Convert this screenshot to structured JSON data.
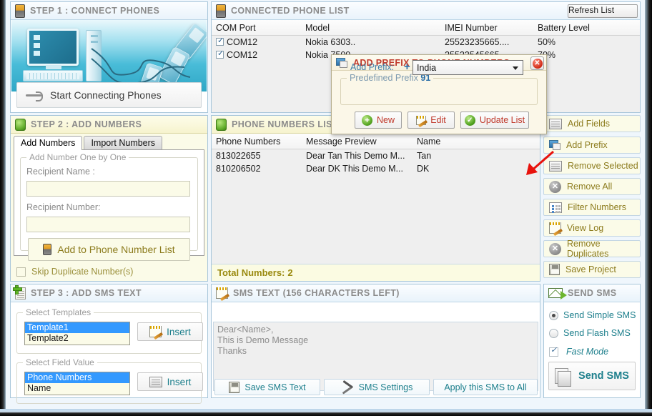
{
  "step1": {
    "title": "STEP 1 : CONNECT PHONES",
    "icon": "mobile-phone-icon",
    "start_button": "Start Connecting Phones",
    "usb_icon": "usb-icon"
  },
  "connected_phone_list": {
    "title": "CONNECTED PHONE LIST",
    "icon": "mobile-phone-icon",
    "refresh_label": "Refresh List",
    "columns": [
      "COM  Port",
      "Model",
      "IMEI Number",
      "Battery Level"
    ],
    "rows": [
      {
        "checked": true,
        "com_port": "COM12",
        "model": "Nokia 6303..",
        "imei": "25523235665....",
        "battery": "50%"
      },
      {
        "checked": true,
        "com_port": "COM12",
        "model": "Nokia 7500..",
        "imei": "25522545665....",
        "battery": "70%"
      }
    ]
  },
  "step2": {
    "title": "STEP 2 : ADD NUMBERS",
    "icon": "green-phone-icon",
    "tabs": [
      {
        "label": "Add Numbers",
        "active": true
      },
      {
        "label": "Import Numbers",
        "active": false
      }
    ],
    "group_legend": "Add Number One by One",
    "recipient_name_label": "Recipient Name :",
    "recipient_name_value": "",
    "recipient_number_label": "Recipient Number:",
    "recipient_number_value": "",
    "add_button": "Add to Phone Number List",
    "skip_duplicate_label": "Skip Duplicate Number(s)",
    "skip_duplicate_checked": false
  },
  "phone_numbers_list": {
    "title": "PHONE NUMBERS LIST",
    "icon": "green-phone-icon",
    "columns": [
      "Phone Numbers",
      "Message Preview",
      "Name",
      ""
    ],
    "rows": [
      {
        "number": "813022655",
        "preview": "Dear Tan This Demo M...",
        "name": "Tan"
      },
      {
        "number": "810206502",
        "preview": "Dear DK This Demo M...",
        "name": "DK"
      }
    ],
    "total_label": "Total Numbers:",
    "total_value": "2"
  },
  "tools": [
    {
      "label": "Add Fields",
      "icon": "fields-card-icon"
    },
    {
      "label": "Add Prefix",
      "icon": "prefix-monitor-icon"
    },
    {
      "label": "Remove Selected",
      "icon": "remove-selected-card-icon"
    },
    {
      "label": "Remove All",
      "icon": "remove-all-x-icon"
    },
    {
      "label": "Filter Numbers",
      "icon": "filter-list-icon"
    },
    {
      "label": "View Log",
      "icon": "view-log-pencil-icon"
    },
    {
      "label": "Remove Duplicates",
      "icon": "remove-duplicates-x-icon"
    },
    {
      "label": "Save Project",
      "icon": "save-disk-icon"
    }
  ],
  "step3": {
    "title": "STEP 3 : ADD SMS TEXT",
    "icon": "document-plus-icon",
    "templates_legend": "Select Templates",
    "templates": [
      {
        "label": "Template1",
        "selected": true
      },
      {
        "label": "Template2",
        "selected": false
      }
    ],
    "templates_insert": "Insert",
    "templates_insert_icon": "pencil-pad-icon",
    "fields_legend": "Select Field Value",
    "fields": [
      {
        "label": "Phone Numbers",
        "selected": true
      },
      {
        "label": "Name",
        "selected": false
      }
    ],
    "fields_insert": "Insert",
    "fields_insert_icon": "fields-card-icon"
  },
  "sms_text": {
    "title": "SMS TEXT (156 CHARACTERS LEFT)",
    "icon": "notepad-pencil-icon",
    "body": "Dear<Name>,\nThis is Demo Message\nThanks",
    "buttons": [
      {
        "label": "Save SMS Text",
        "icon": "save-disk-icon"
      },
      {
        "label": "SMS Settings",
        "icon": "hammer-wrench-icon"
      },
      {
        "label": "Apply this SMS to All",
        "icon": "none"
      }
    ]
  },
  "send_sms": {
    "title": "SEND SMS",
    "icon": "envelope-arrow-icon",
    "options": [
      {
        "label": "Send Simple SMS",
        "selected": true
      },
      {
        "label": "Send Flash SMS",
        "selected": false
      }
    ],
    "fast_mode_label": "Fast Mode",
    "fast_mode_checked": true,
    "send_button": "Send SMS",
    "send_button_icon": "send-pages-icon"
  },
  "dialog": {
    "title": "ADD PREFIX TO PHONE NUMBERS",
    "icon": "prefix-monitor-icon",
    "close_icon": "close-x-icon",
    "group_legend": "Predefined Prefix",
    "group_legend_value": "91",
    "add_prefix_label": "Add Prefix:",
    "plus_icon": "plus-icon",
    "selected_country": "India",
    "dropdown_icon": "chevron-down-icon",
    "buttons": [
      {
        "label": "New",
        "icon": "green-plus-circle-icon"
      },
      {
        "label": "Edit",
        "icon": "pencil-pad-icon"
      },
      {
        "label": "Update List",
        "icon": "green-check-circle-icon"
      }
    ]
  },
  "annotation": {
    "arrow_icon": "red-arrow-pointer",
    "color": "#e8120c"
  }
}
